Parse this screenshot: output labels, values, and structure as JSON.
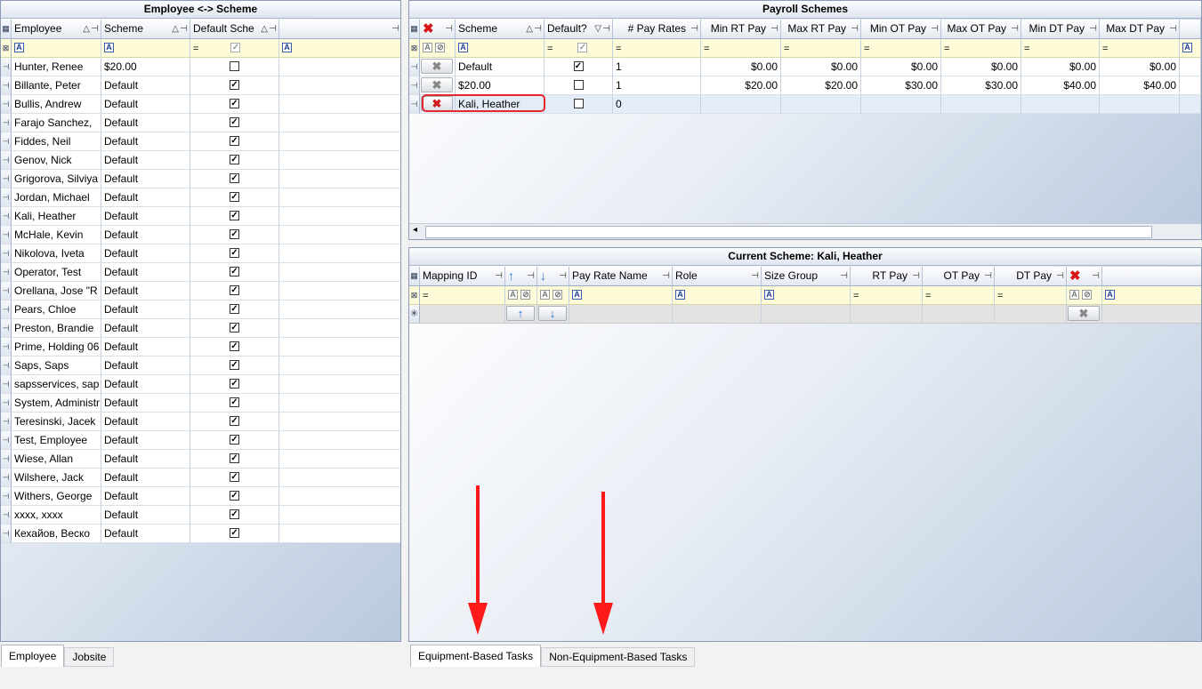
{
  "left_pane": {
    "title": "Employee <-> Scheme",
    "columns": [
      "Employee",
      "Scheme",
      "Default Sche"
    ],
    "rows": [
      {
        "employee": "Hunter, Renee",
        "scheme": "$20.00",
        "default": false
      },
      {
        "employee": "Billante, Peter",
        "scheme": "Default",
        "default": true
      },
      {
        "employee": "Bullis, Andrew",
        "scheme": "Default",
        "default": true
      },
      {
        "employee": "Farajo Sanchez,",
        "scheme": "Default",
        "default": true
      },
      {
        "employee": "Fiddes, Neil",
        "scheme": "Default",
        "default": true
      },
      {
        "employee": "Genov, Nick",
        "scheme": "Default",
        "default": true
      },
      {
        "employee": "Grigorova, Silviya",
        "scheme": "Default",
        "default": true
      },
      {
        "employee": "Jordan, Michael",
        "scheme": "Default",
        "default": true
      },
      {
        "employee": "Kali, Heather",
        "scheme": "Default",
        "default": true
      },
      {
        "employee": "McHale, Kevin",
        "scheme": "Default",
        "default": true
      },
      {
        "employee": "Nikolova, Iveta",
        "scheme": "Default",
        "default": true
      },
      {
        "employee": "Operator, Test",
        "scheme": "Default",
        "default": true
      },
      {
        "employee": "Orellana, Jose \"R",
        "scheme": "Default",
        "default": true
      },
      {
        "employee": "Pears, Chloe",
        "scheme": "Default",
        "default": true
      },
      {
        "employee": "Preston, Brandie",
        "scheme": "Default",
        "default": true
      },
      {
        "employee": "Prime, Holding 06",
        "scheme": "Default",
        "default": true
      },
      {
        "employee": "Saps, Saps",
        "scheme": "Default",
        "default": true
      },
      {
        "employee": "sapsservices, sap",
        "scheme": "Default",
        "default": true
      },
      {
        "employee": "System, Administr",
        "scheme": "Default",
        "default": true
      },
      {
        "employee": "Teresinski, Jacek",
        "scheme": "Default",
        "default": true
      },
      {
        "employee": "Test, Employee",
        "scheme": "Default",
        "default": true
      },
      {
        "employee": "Wiese, Allan",
        "scheme": "Default",
        "default": true
      },
      {
        "employee": "Wilshere, Jack",
        "scheme": "Default",
        "default": true
      },
      {
        "employee": "Withers, George",
        "scheme": "Default",
        "default": true
      },
      {
        "employee": "xxxx, xxxx",
        "scheme": "Default",
        "default": true
      },
      {
        "employee": "Кехайов, Веско",
        "scheme": "Default",
        "default": true
      }
    ],
    "tabs": [
      "Employee",
      "Jobsite"
    ]
  },
  "schemes_pane": {
    "title": "Payroll Schemes",
    "columns": [
      "Scheme",
      "Default?",
      "# Pay Rates",
      "Min RT Pay",
      "Max RT Pay",
      "Min OT Pay",
      "Max OT Pay",
      "Min DT Pay",
      "Max DT Pay"
    ],
    "rows": [
      {
        "scheme": "Default",
        "default": true,
        "pay_rates": "1",
        "min_rt": "$0.00",
        "max_rt": "$0.00",
        "min_ot": "$0.00",
        "max_ot": "$0.00",
        "min_dt": "$0.00",
        "max_dt": "$0.00"
      },
      {
        "scheme": "$20.00",
        "default": false,
        "pay_rates": "1",
        "min_rt": "$20.00",
        "max_rt": "$20.00",
        "min_ot": "$30.00",
        "max_ot": "$30.00",
        "min_dt": "$40.00",
        "max_dt": "$40.00"
      },
      {
        "scheme": "Kali, Heather",
        "default": false,
        "pay_rates": "0",
        "min_rt": "",
        "max_rt": "",
        "min_ot": "",
        "max_ot": "",
        "min_dt": "",
        "max_dt": ""
      }
    ]
  },
  "current_pane": {
    "title": "Current Scheme: Kali, Heather",
    "columns": [
      "Mapping ID",
      "Pay Rate Name",
      "Role",
      "Size Group",
      "RT Pay",
      "OT Pay",
      "DT Pay"
    ],
    "tabs": [
      "Equipment-Based Tasks",
      "Non-Equipment-Based Tasks"
    ]
  },
  "icons": {
    "check": "✓",
    "close": "✕",
    "pin": "⊣",
    "filter": "A",
    "equals": "=",
    "up": "↑",
    "down": "↓",
    "new_row": "✳"
  },
  "colors": {
    "accent_red": "#e5262b",
    "header_border": "#8a9bb3",
    "filter_bg": "#fdfbd8"
  }
}
